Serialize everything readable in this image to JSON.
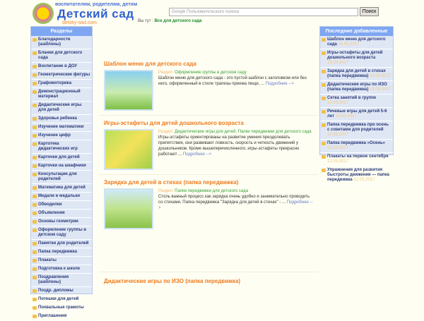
{
  "header": {
    "slogan": "воспитателям, родителям, детям",
    "brand": "Детский сад",
    "domain": "detsky-sad.com",
    "search_placeholder": "Google Пользовательского поиска",
    "search_button": "Поиск",
    "breadcrumb_label": "Вы тут :",
    "breadcrumb_current": "Все для детского сада"
  },
  "left": {
    "title": "Разделы",
    "items": [
      "Благодарности (шаблоны)",
      "Бланки для детского сада",
      "Воспитание в ДОУ",
      "Геометрические фигуры",
      "Графомоторика",
      "Демонстрационный материал",
      "Дидактические игры для детей",
      "Здоровье ребенка",
      "Изучение математики",
      "Изучение цифр",
      "Картотека дидактических игр",
      "Карточки для детей",
      "Карточки на шкафчики",
      "Консультации для родителей",
      "Математика для детей",
      "Медали и медальки",
      "Обводилки",
      "Объявления",
      "Основы геометрии",
      "Оформление группы в детском саду",
      "Памятки для родителей",
      "Папка передвижка",
      "Плакаты",
      "Подготовка к школе",
      "Поздравления (шаблоны)",
      "Поздр. дипломы",
      "Потешки для детей",
      "Похвальные грамоты",
      "Приглашения"
    ]
  },
  "right": {
    "title": "Последние добавленные",
    "items": [
      {
        "t": "Шаблон меню для детского сада",
        "d": "16.03.2017"
      },
      {
        "t": "Игры-эстафеты для детей дошкольного возраста",
        "d": "15.03.2017"
      },
      {
        "t": "Зарядка для детей в стихах (папка передвижка)",
        "d": "13.03.2017"
      },
      {
        "t": "Дидактические игры по ИЗО (папка передвижка)",
        "d": "13.03.2017"
      },
      {
        "t": "Сетка занятий в группе",
        "d": "13.03.2017"
      },
      {
        "t": "Речевые игры для детей 5-6 лет",
        "d": "13.03.2017"
      },
      {
        "t": "Папка передвижка про осень с советами для родителей",
        "d": "13.03.2017"
      },
      {
        "t": "Папка передвижка «Осень»",
        "d": "13.03.2017"
      },
      {
        "t": "Плакаты на первое сентября",
        "d": "12.03.2017"
      },
      {
        "t": "Упражнения для развития быстроты движения — папка передвижка",
        "d": "12.03.2017"
      }
    ]
  },
  "posts": [
    {
      "title": "Шаблон меню для детского сада",
      "section_label": "Раздел:",
      "section": "Оформление группы в детском саду",
      "text": "Шаблон меню для детского сада - это пустой шаблон с заголовком или без него, оформленный в стиле трапезы приема пищи, ...",
      "more": "Подробнее -->"
    },
    {
      "title": "Игры-эстафеты для детей дошкольного возраста",
      "section_label": "Раздел:",
      "section": "Дидактические игры для детей. Папки передвижки для детского сада",
      "text": "Игры-эстафеты ориентированы на развитие умения преодолевать препятствия, они развивают ловкость, скорость и четкость движений у дошкольников. Кроме вышеперечисленного, игры-эстафеты прекрасно работают ...",
      "more": "Подробнее -->"
    },
    {
      "title": "Зарядка для детей в стихах (папка передвижка)",
      "section_label": "Раздел:",
      "section": "Папки передвижки для детского сада",
      "text": "Столь важный процесс как зарядка очень удобно и занимательно проводить со стихами. Папка передвижка \"Зарядка для детей в стихах\" - ...",
      "more": "Подробнее -->"
    },
    {
      "title": "Дидактические игры по ИЗО (папка передвижка)"
    }
  ]
}
